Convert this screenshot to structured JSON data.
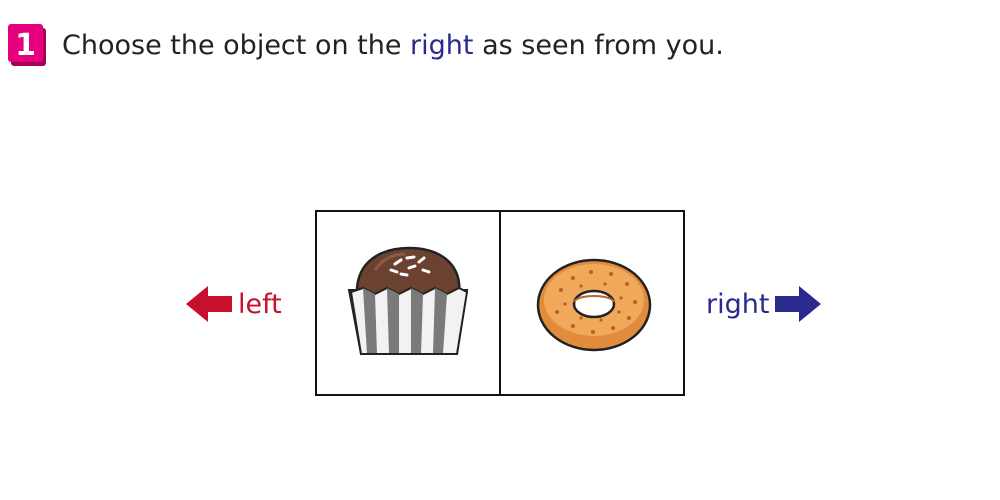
{
  "question": {
    "number": "1",
    "text_before": "Choose the object on the ",
    "keyword": "right",
    "text_after": " as seen from you.",
    "number_color": "#e6007e",
    "keyword_color": "#2a2a8e"
  },
  "choices": [
    {
      "object": "chocolate-cupcake"
    },
    {
      "object": "donut"
    }
  ],
  "directions": {
    "left_label": "left",
    "right_label": "right",
    "left_color": "#c8102e",
    "right_color": "#2a2a8e",
    "left_icon": "arrow-left-icon",
    "right_icon": "arrow-right-icon"
  }
}
